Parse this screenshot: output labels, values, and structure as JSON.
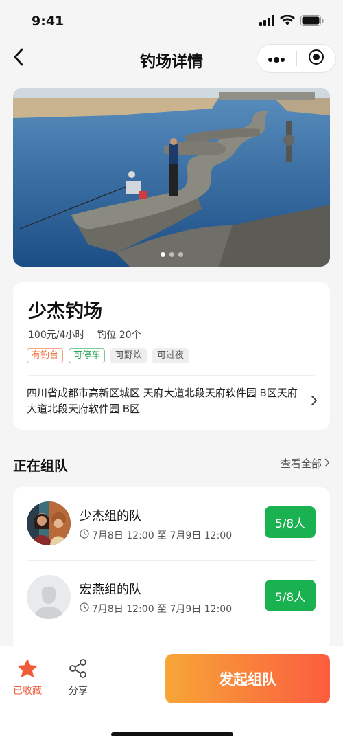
{
  "status": {
    "time": "9:41"
  },
  "nav": {
    "title": "钓场详情"
  },
  "hero": {
    "slide_count": 3,
    "active_slide": 1
  },
  "venue": {
    "name": "少杰钓场",
    "price": "100元/4小时",
    "spots": "钓位 20个",
    "tags": [
      {
        "label": "有钓台",
        "style": "orange"
      },
      {
        "label": "可停车",
        "style": "green"
      },
      {
        "label": "可野炊",
        "style": "gray"
      },
      {
        "label": "可过夜",
        "style": "gray"
      }
    ],
    "address": "四川省成都市高新区城区 天府大道北段天府软件园 B区天府大道北段天府软件园 B区"
  },
  "teams_section": {
    "title": "正在组队",
    "view_all": "查看全部"
  },
  "teams": [
    {
      "name": "少杰组的队",
      "time": "7月8日 12:00 至 7月9日 12:00",
      "count": "5/8人"
    },
    {
      "name": "宏燕组的队",
      "time": "7月8日 12:00 至 7月9日 12:00",
      "count": "5/8人"
    }
  ],
  "bottom": {
    "favorite_label": "已收藏",
    "share_label": "分享",
    "cta_label": "发起组队"
  },
  "colors": {
    "accent_green": "#1ab150",
    "accent_orange": "#f05b3a",
    "cta_start": "#f7a637",
    "cta_end": "#fb5d3f"
  }
}
